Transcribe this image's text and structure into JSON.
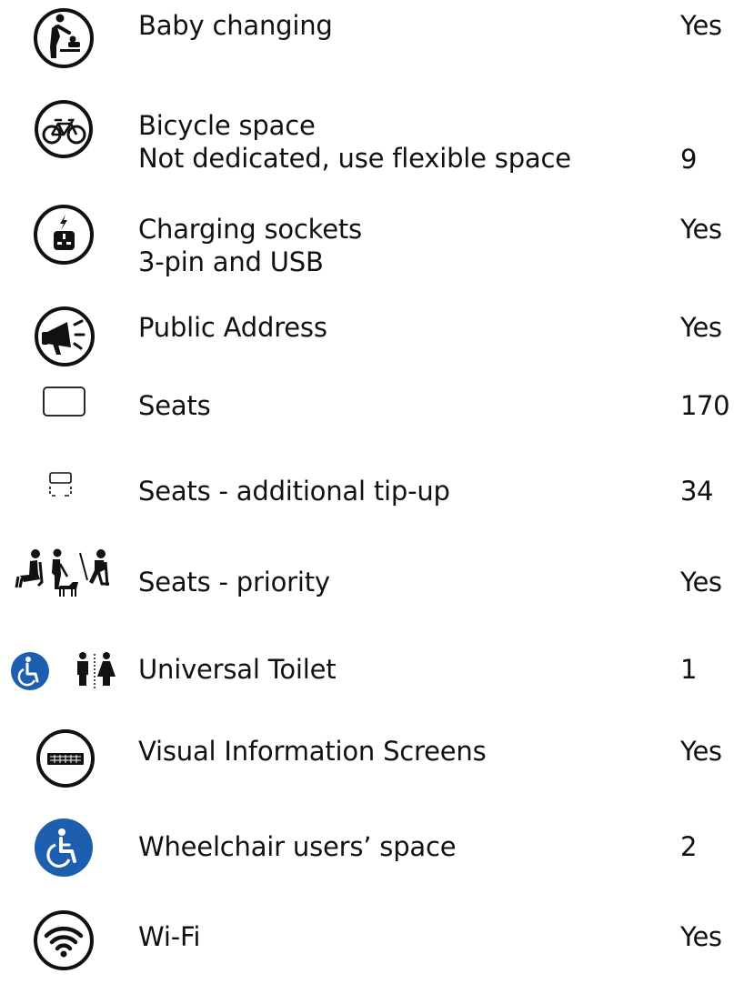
{
  "accent_color": "#1d5fae",
  "facilities": [
    {
      "icon": "baby-changing-icon",
      "label": "Baby changing",
      "value": "Yes"
    },
    {
      "icon": "bicycle-icon",
      "label": "Bicycle space",
      "detail": "Not dedicated, use flexible space",
      "value": "9"
    },
    {
      "icon": "charging-socket-icon",
      "label": "Charging sockets",
      "detail": "3-pin and USB",
      "value": "Yes"
    },
    {
      "icon": "megaphone-icon",
      "label": "Public Address",
      "value": "Yes"
    },
    {
      "icon": "seat-icon",
      "label": "Seats",
      "value": "170"
    },
    {
      "icon": "tip-up-seat-icon",
      "label": "Seats - additional tip-up",
      "value": "34"
    },
    {
      "icon": "priority-seat-icon",
      "label": "Seats - priority",
      "value": "Yes"
    },
    {
      "icon": "universal-toilet-icon",
      "label": "Universal Toilet",
      "value": "1"
    },
    {
      "icon": "information-screen-icon",
      "label": "Visual Information Screens",
      "value": "Yes"
    },
    {
      "icon": "wheelchair-icon",
      "label": "Wheelchair users’ space",
      "value": "2"
    },
    {
      "icon": "wifi-icon",
      "label": "Wi-Fi",
      "value": "Yes"
    }
  ]
}
